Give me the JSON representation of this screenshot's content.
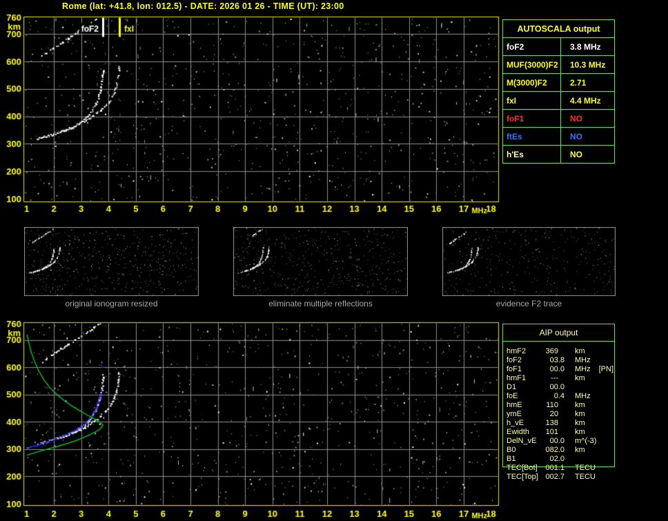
{
  "header": {
    "title": "Rome (lat: +41.8, lon: 012.5) - DATE: 2026 01 26 - TIME (UT): 23:00"
  },
  "colors": {
    "background": "#000000",
    "axis_yellow": "#e8e800",
    "label_yellow": "#ffff00",
    "grid_gray": "#929292",
    "panel_green": "#54e554",
    "caption_gray": "#a8a8a8",
    "profile_green": "#00c828",
    "scaled_trace_blue": "#2222e8",
    "aip_text": "#ffffa0",
    "autoscala_white": "#ffffff",
    "autoscala_red": "#ff2a2a",
    "autoscala_blue": "#2277ff",
    "echo_white": "#ffffff"
  },
  "autoscala": {
    "title": "AUTOSCALA output",
    "rows": [
      {
        "label": "foF2",
        "value": "3.8 MHz",
        "color": "#ffffff",
        "value_color": "#ffffff"
      },
      {
        "label": "MUF(3000)F2",
        "value": "10.3 MHz",
        "color": "#ffff00",
        "value_color": "#ffff00"
      },
      {
        "label": "M(3000)F2",
        "value": "2.71",
        "color": "#ffff00",
        "value_color": "#ffff00"
      },
      {
        "label": "fxI",
        "value": "4.4 MHz",
        "color": "#ffff00",
        "value_color": "#ffff00"
      },
      {
        "label": "foF1",
        "value": "NO",
        "color": "#ff2a2a",
        "value_color": "#ff2a2a"
      },
      {
        "label": "ftEs",
        "value": "NO",
        "color": "#2277ff",
        "value_color": "#2277ff"
      },
      {
        "label": "h'Es",
        "value": "NO",
        "color": "#ffffbb",
        "value_color": "#ffff44"
      }
    ]
  },
  "aip": {
    "title": "AIP output",
    "rows": [
      {
        "label": "hmF2",
        "value": "369",
        "unit": "km",
        "note": ""
      },
      {
        "label": "foF2",
        "value": "03.8",
        "unit": "MHz",
        "note": ""
      },
      {
        "label": "foF1",
        "value": "00.0",
        "unit": "MHz",
        "note": "[PN]"
      },
      {
        "label": "hmF1",
        "value": "---",
        "unit": "km",
        "note": ""
      },
      {
        "label": "D1",
        "value": "00.0",
        "unit": "",
        "note": ""
      },
      {
        "label": "foE",
        "value": "0.4",
        "unit": "MHz",
        "note": ""
      },
      {
        "label": "hmE",
        "value": "110",
        "unit": "km",
        "note": ""
      },
      {
        "label": "ymE",
        "value": "20",
        "unit": "km",
        "note": ""
      },
      {
        "label": "h_vE",
        "value": "138",
        "unit": "km",
        "note": ""
      },
      {
        "label": "Ewidth",
        "value": "101",
        "unit": "km",
        "note": ""
      },
      {
        "label": "DelN_vE",
        "value": "00.0",
        "unit": "m^(-3)",
        "note": ""
      },
      {
        "label": "B0",
        "value": "082.0",
        "unit": "km",
        "note": ""
      },
      {
        "label": "B1",
        "value": "02.0",
        "unit": "",
        "note": ""
      },
      {
        "label": "TEC[Bot]",
        "value": "001.1",
        "unit": "TECU",
        "note": ""
      },
      {
        "label": "TEC[Top]",
        "value": "002.7",
        "unit": "TECU",
        "note": ""
      }
    ]
  },
  "thumbnails": [
    {
      "caption": "original ionogram resized",
      "noise_seed": 21,
      "noise_count": 520,
      "second_hop_min_km": 100,
      "echo_series_source": 0
    },
    {
      "caption": "eliminate multiple reflections",
      "noise_seed": 22,
      "noise_count": 470,
      "second_hop_min_km": 688,
      "echo_series_source": 0
    },
    {
      "caption": "evidence F2 trace",
      "noise_seed": 23,
      "noise_count": 310,
      "second_hop_min_km": 620,
      "echo_series_source": 0
    }
  ],
  "chart_data": [
    {
      "type": "scatter",
      "name": "autoscala ionogram",
      "xlabel": "MHz",
      "ylabel": "km",
      "xlim": [
        1,
        18
      ],
      "ylim": [
        100,
        760
      ],
      "x_ticks": [
        1,
        2,
        3,
        4,
        5,
        6,
        7,
        8,
        9,
        10,
        11,
        12,
        13,
        14,
        15,
        16,
        17,
        18
      ],
      "y_ticks": [
        760,
        700,
        600,
        500,
        400,
        300,
        200,
        100
      ],
      "grid": true,
      "annotations": {
        "foF2_line_MHz": 3.8,
        "foF2_label": "foF2",
        "fxI_line_MHz": 4.4,
        "fxI_label": "fxI"
      },
      "series": [
        {
          "name": "F2 echo o-mode",
          "color": "#ffffff",
          "points": [
            [
              1.35,
              320
            ],
            [
              1.5,
              324
            ],
            [
              1.65,
              328
            ],
            [
              1.8,
              332
            ],
            [
              1.95,
              336
            ],
            [
              2.1,
              341
            ],
            [
              2.25,
              346
            ],
            [
              2.4,
              352
            ],
            [
              2.55,
              358
            ],
            [
              2.7,
              365
            ],
            [
              2.85,
              373
            ],
            [
              3.0,
              382
            ],
            [
              3.12,
              392
            ],
            [
              3.24,
              404
            ],
            [
              3.34,
              417
            ],
            [
              3.44,
              432
            ],
            [
              3.52,
              448
            ],
            [
              3.6,
              466
            ],
            [
              3.66,
              486
            ],
            [
              3.71,
              507
            ],
            [
              3.74,
              527
            ],
            [
              3.76,
              546
            ],
            [
              3.78,
              562
            ],
            [
              3.79,
              575
            ]
          ]
        },
        {
          "name": "F2 echo x-mode",
          "color": "#ffffff",
          "points": [
            [
              2.2,
              342
            ],
            [
              2.35,
              348
            ],
            [
              2.5,
              354
            ],
            [
              2.65,
              360
            ],
            [
              2.8,
              367
            ],
            [
              2.95,
              374
            ],
            [
              3.1,
              382
            ],
            [
              3.25,
              391
            ],
            [
              3.4,
              401
            ],
            [
              3.55,
              412
            ],
            [
              3.7,
              424
            ],
            [
              3.85,
              438
            ],
            [
              3.98,
              453
            ],
            [
              4.1,
              470
            ],
            [
              4.19,
              489
            ],
            [
              4.26,
              510
            ],
            [
              4.31,
              532
            ],
            [
              4.34,
              553
            ],
            [
              4.36,
              571
            ],
            [
              4.37,
              582
            ]
          ]
        },
        {
          "name": "second reflection",
          "color": "#ffffff",
          "points": [
            [
              1.55,
              622
            ],
            [
              1.72,
              634
            ],
            [
              1.9,
              646
            ],
            [
              2.08,
              658
            ],
            [
              2.28,
              671
            ],
            [
              2.5,
              685
            ],
            [
              2.73,
              700
            ],
            [
              2.97,
              716
            ],
            [
              3.2,
              732
            ],
            [
              3.44,
              748
            ],
            [
              3.68,
              762
            ]
          ]
        }
      ],
      "noise": {
        "seed": 7,
        "count": 850
      }
    },
    {
      "type": "scatter",
      "name": "ionogram with AIP restored profile",
      "xlabel": "MHz",
      "ylabel": "km",
      "xlim": [
        1,
        18
      ],
      "ylim": [
        100,
        760
      ],
      "x_ticks": [
        1,
        2,
        3,
        4,
        5,
        6,
        7,
        8,
        9,
        10,
        11,
        12,
        13,
        14,
        15,
        16,
        17,
        18
      ],
      "y_ticks": [
        760,
        700,
        600,
        500,
        400,
        300,
        200,
        100
      ],
      "grid": true,
      "annotations": {},
      "echo_series_source": 0,
      "scaled_trace": {
        "name": "autoscala scaled F2 trace",
        "color": "#2222e8",
        "points": [
          [
            1.0,
            306
          ],
          [
            1.15,
            311
          ],
          [
            1.32,
            316
          ],
          [
            1.5,
            322
          ],
          [
            1.68,
            328
          ],
          [
            1.86,
            334
          ],
          [
            2.04,
            340
          ],
          [
            2.22,
            347
          ],
          [
            2.4,
            354
          ],
          [
            2.58,
            362
          ],
          [
            2.76,
            371
          ],
          [
            2.92,
            381
          ],
          [
            3.07,
            392
          ],
          [
            3.2,
            404
          ],
          [
            3.32,
            418
          ],
          [
            3.43,
            434
          ],
          [
            3.52,
            452
          ],
          [
            3.6,
            472
          ],
          [
            3.66,
            493
          ],
          [
            3.7,
            510
          ],
          [
            3.72,
            520
          ]
        ],
        "extra_points": [
          [
            3.74,
            608
          ]
        ]
      },
      "profile": {
        "name": "AIP electron density profile",
        "color": "#00c828",
        "points": [
          [
            1.02,
            720
          ],
          [
            1.08,
            690
          ],
          [
            1.17,
            656
          ],
          [
            1.29,
            622
          ],
          [
            1.44,
            588
          ],
          [
            1.62,
            556
          ],
          [
            1.84,
            527
          ],
          [
            2.1,
            501
          ],
          [
            2.38,
            478
          ],
          [
            2.68,
            457
          ],
          [
            2.98,
            439
          ],
          [
            3.26,
            423
          ],
          [
            3.5,
            410
          ],
          [
            3.68,
            399
          ],
          [
            3.79,
            389
          ],
          [
            3.77,
            383
          ],
          [
            3.68,
            373
          ],
          [
            3.53,
            364
          ],
          [
            3.33,
            354
          ],
          [
            3.09,
            343
          ],
          [
            2.82,
            332
          ],
          [
            2.53,
            322
          ],
          [
            2.22,
            313
          ],
          [
            1.9,
            304
          ],
          [
            1.57,
            295
          ],
          [
            1.27,
            286
          ],
          [
            1.0,
            278
          ]
        ]
      },
      "noise": {
        "seed": 13,
        "count": 800
      }
    }
  ]
}
